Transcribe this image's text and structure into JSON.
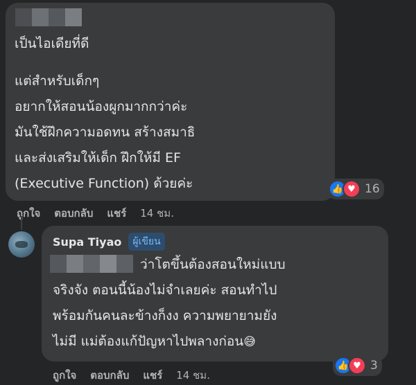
{
  "comments": [
    {
      "paragraph1": "เป็นไอเดียที่ดี",
      "lines": [
        "แต่สำหรับเด็กๆ",
        "อยากให้สอนน้องผูกมากกว่าค่ะ",
        "มันใช้ฝึกความอดทน สร้างสมาธิ",
        "และส่งเสริมให้เด็ก ฝึกให้มี EF",
        "(Executive Function) ด้วยค่ะ"
      ],
      "reaction_count": "16",
      "actions": {
        "like": "ถูกใจ",
        "reply": "ตอบกลับ",
        "share": "แชร์",
        "time": "14 ชม."
      }
    },
    {
      "author": "Supa Tiyao",
      "author_badge": "ผู้เขียน",
      "lines": [
        "ว่าโตขึ้นต้องสอนใหม่แบบ",
        "จริงจัง ตอนนี้น้องไม่จำเลยค่ะ สอนทำไป",
        "พร้อมกันคนละข้างก็งง ความพยายามยัง",
        "ไม่มี แม่ต้องแก้ปัญหาไปพลางก่อน"
      ],
      "emoji": "😅",
      "reaction_count": "3",
      "actions": {
        "like": "ถูกใจ",
        "reply": "ตอบกลับ",
        "share": "แชร์",
        "time": "14 ชม."
      }
    }
  ],
  "icons": {
    "like": "like-icon",
    "love": "love-icon"
  },
  "colors": {
    "background": "#242526",
    "bubble": "#3a3b3c",
    "text": "#e4e6eb",
    "muted": "#b0b3b8",
    "like": "#1877f2",
    "love": "#f33e58"
  }
}
